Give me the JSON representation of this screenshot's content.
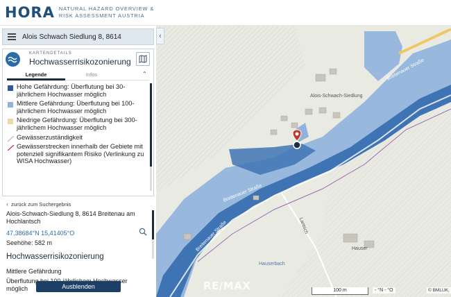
{
  "header": {
    "logo": "HORA",
    "tagline_line1": "Natural Hazard Overview &",
    "tagline_line2": "Risk Assessment Austria"
  },
  "search": {
    "value": "Alois Schwach Siedlung 8, 8614"
  },
  "card": {
    "kicker": "KARTENDETAILS",
    "title": "Hochwasserrisikozonierung",
    "tabs": [
      {
        "label": "Legende",
        "active": true
      },
      {
        "label": "Infos",
        "active": false
      }
    ],
    "legend": [
      {
        "label": "Hohe Gefährdung: Überflutung bei 30-jährlichem Hochwasser möglich",
        "color": "#2e5a9c"
      },
      {
        "label": "Mittlere Gefährdung: Überflutung bei 100-jährlichem Hochwasser möglich",
        "color": "#8fb3dc"
      },
      {
        "label": "Niedrige Gefährdung: Überflutung bei 300-jährlichem Hochwasser möglich",
        "color": "#f2d7a6"
      },
      {
        "label": "Gewässerzuständigkeit",
        "color": "#d9a0c8"
      },
      {
        "label": "Gewässerstrecken innerhalb der Gebiete mit potenziell signifikantem Risiko (Verlinkung zu WISA Hochwasser)",
        "color": "#c2185b"
      }
    ]
  },
  "info": {
    "back_label": "zurück zum Suchergebnis",
    "address": "Alois-Schwach-Siedlung 8, 8614 Breitenau am Hochlantsch",
    "coordinates": "47,38684°N 15,41405°O",
    "elevation": "Seehöhe: 582 m",
    "section_title": "Hochwasserrisikozonierung",
    "result_level": "Mittlere Gefährdung",
    "result_text": "Überflutung bei 100-jährlichem Hochwasser möglich"
  },
  "hide_button": "Ausblenden",
  "map": {
    "labels": {
      "village": "Alois-Schwach-Siedlung",
      "road1": "Breitenauer Straße",
      "road2": "Breitenauer Straße",
      "road3": "Breitenauer Straße",
      "lantsch": "Lantsch",
      "hauser": "Hauser",
      "stream": "Hauserbach"
    },
    "watermark": "RE/MAX",
    "scale": "100 m",
    "coord_readout": "- °N - °O",
    "attribution": "© BMLUK,",
    "colors": {
      "high": "#3f74b4",
      "medium": "#8fb3dc",
      "background": "#e9ebe3",
      "road": "#f0c766"
    }
  }
}
